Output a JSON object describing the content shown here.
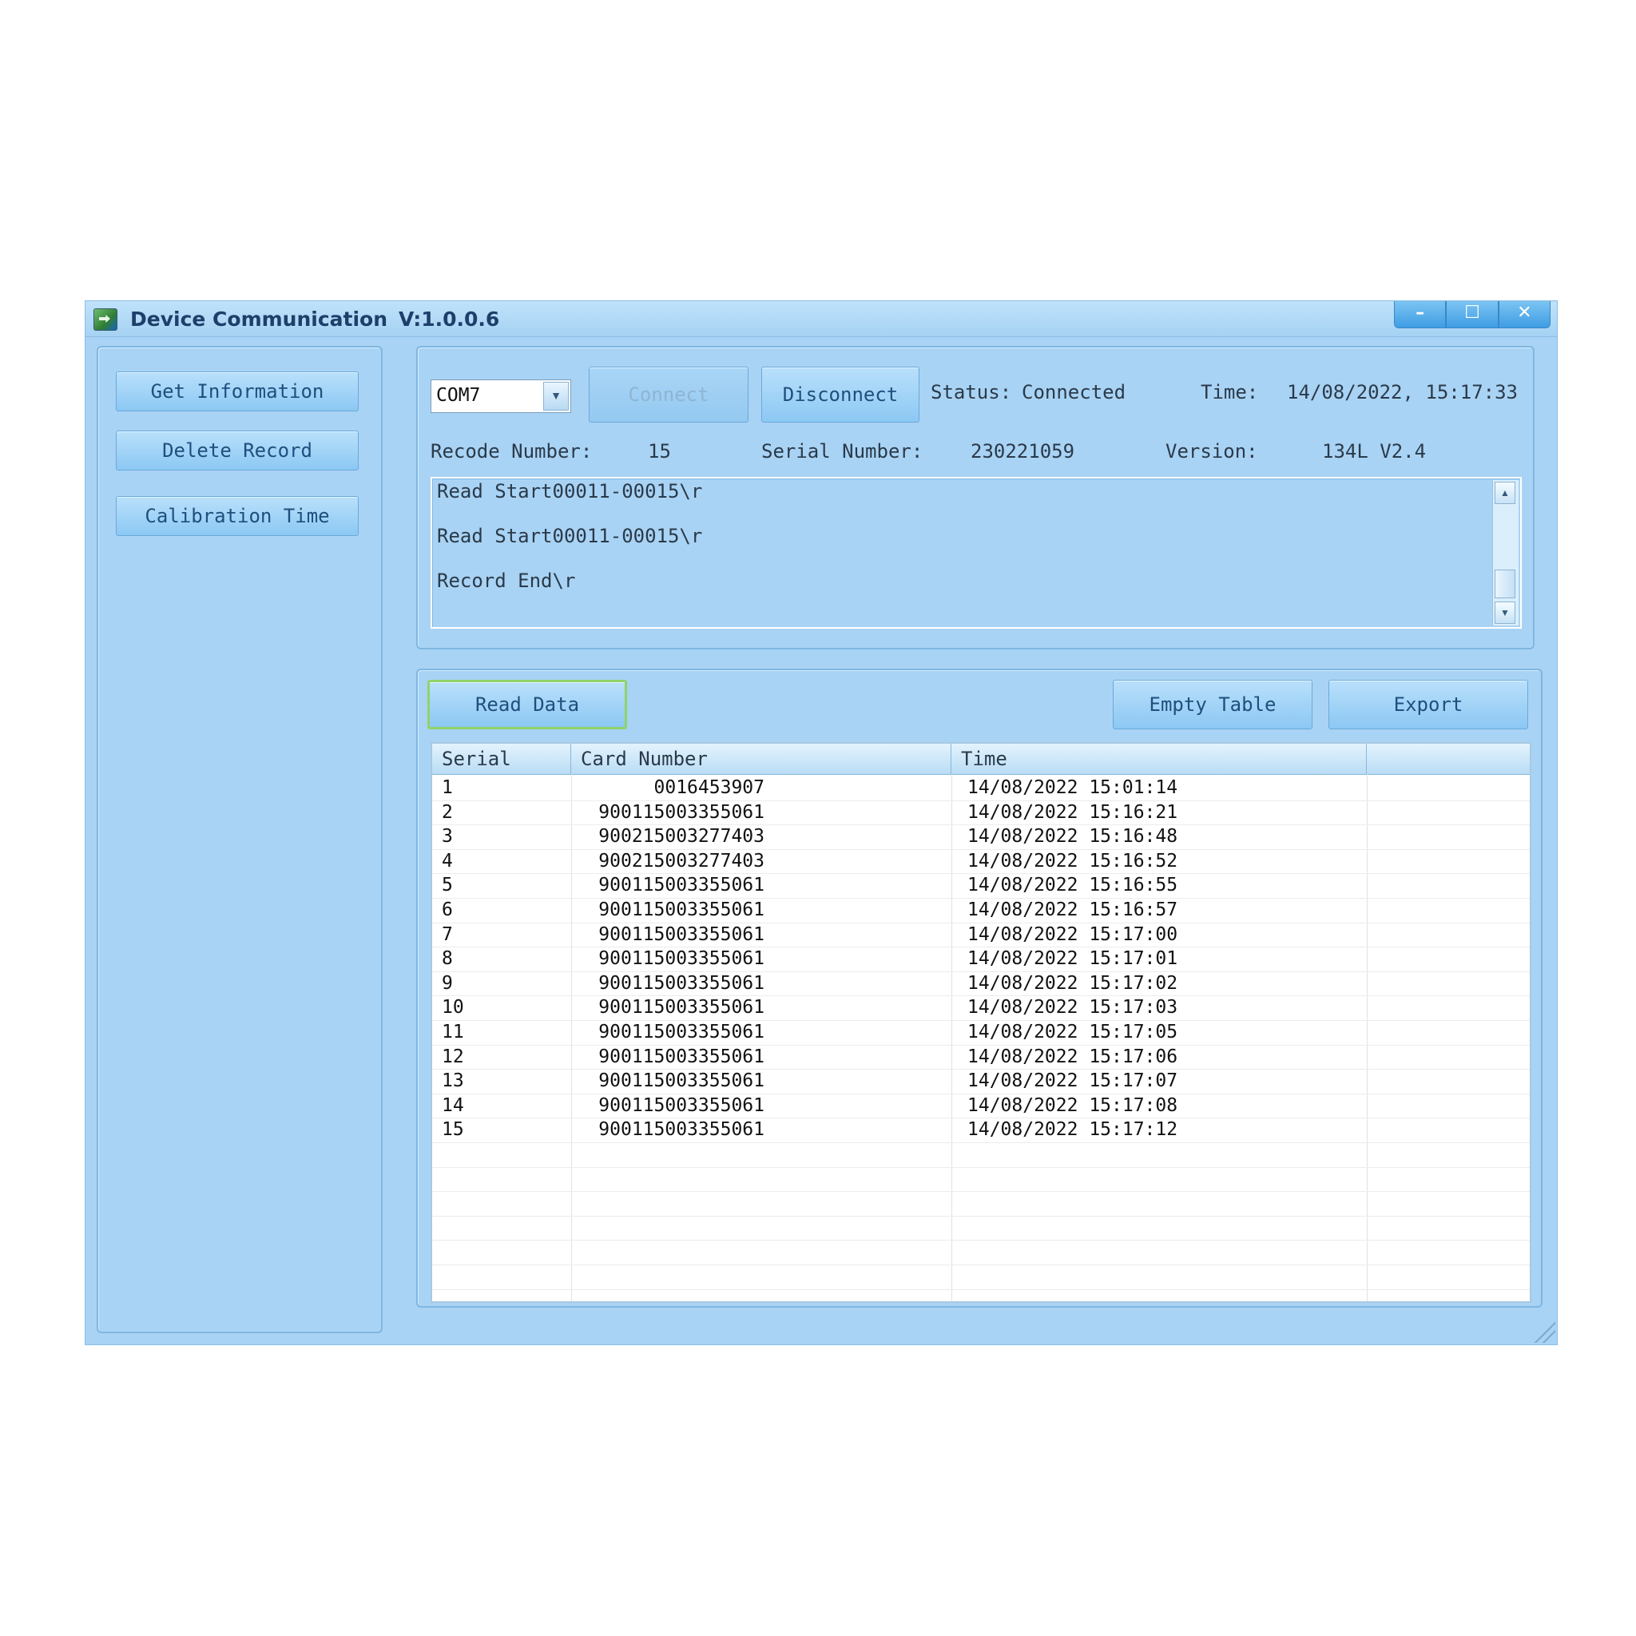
{
  "window": {
    "title": "Device Communication",
    "version": "V:1.0.0.6",
    "controls": {
      "minimize": "–",
      "maximize": "☐",
      "close": "✕"
    }
  },
  "sidebar": {
    "buttons": [
      "Get Information",
      "Delete Record",
      "Calibration Time"
    ]
  },
  "connection": {
    "port": "COM7",
    "connect_label": "Connect",
    "disconnect_label": "Disconnect",
    "status_label": "Status:",
    "status_value": "Connected",
    "time_label": "Time:",
    "time_value": "14/08/2022, 15:17:33"
  },
  "info": {
    "record_label": "Recode Number:",
    "record_value": "15",
    "serial_label": "Serial Number:",
    "serial_value": "230221059",
    "version_label": "Version:",
    "version_value": "134L V2.4"
  },
  "log": {
    "lines": [
      "Read Start00011-00015\\r",
      "Read Start00011-00015\\r",
      "Record End\\r"
    ]
  },
  "table_toolbar": {
    "read_label": "Read Data",
    "empty_label": "Empty Table",
    "export_label": "Export"
  },
  "table": {
    "columns": [
      "Serial",
      "Card Number",
      "Time",
      ""
    ],
    "rows": [
      [
        "1",
        "0016453907",
        "14/08/2022 15:01:14"
      ],
      [
        "2",
        "900115003355061",
        "14/08/2022 15:16:21"
      ],
      [
        "3",
        "900215003277403",
        "14/08/2022 15:16:48"
      ],
      [
        "4",
        "900215003277403",
        "14/08/2022 15:16:52"
      ],
      [
        "5",
        "900115003355061",
        "14/08/2022 15:16:55"
      ],
      [
        "6",
        "900115003355061",
        "14/08/2022 15:16:57"
      ],
      [
        "7",
        "900115003355061",
        "14/08/2022 15:17:00"
      ],
      [
        "8",
        "900115003355061",
        "14/08/2022 15:17:01"
      ],
      [
        "9",
        "900115003355061",
        "14/08/2022 15:17:02"
      ],
      [
        "10",
        "900115003355061",
        "14/08/2022 15:17:03"
      ],
      [
        "11",
        "900115003355061",
        "14/08/2022 15:17:05"
      ],
      [
        "12",
        "900115003355061",
        "14/08/2022 15:17:06"
      ],
      [
        "13",
        "900115003355061",
        "14/08/2022 15:17:07"
      ],
      [
        "14",
        "900115003355061",
        "14/08/2022 15:17:08"
      ],
      [
        "15",
        "900115003355061",
        "14/08/2022 15:17:12"
      ]
    ]
  },
  "colors": {
    "window_bg": "#a9d3f4",
    "title_text": "#1d3f6a",
    "button_text": "#1f4f7d",
    "focus_border": "#8fd46a"
  }
}
